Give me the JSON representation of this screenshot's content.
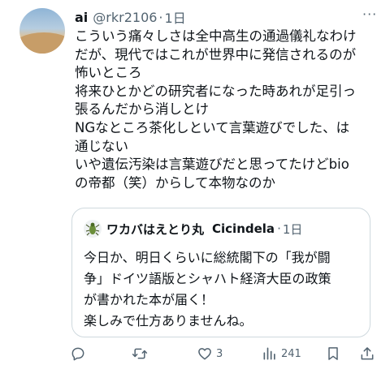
{
  "tweet": {
    "author_name": "ai",
    "author_handle": "@rkr2106",
    "time_sep": "·",
    "time": "1日",
    "more": "···",
    "lines": [
      "こういう痛々しさは全中高生の通過儀礼なわけ",
      "だが、現代ではこれが世界中に発信されるのが",
      "怖いところ",
      "将来ひとかどの研究者になった時あれが足引っ",
      "張るんだから消しとけ",
      "NGなところ茶化しといて言葉遊びでした、は",
      "通じない",
      "いや遺伝汚染は言葉遊びだと思ってたけどbio",
      "の帝都（笑）からして本物なのか"
    ]
  },
  "quoted": {
    "author_name": "ワカバはえとり丸",
    "author_handle": "Cicindela",
    "time_sep": "·",
    "time": "1日",
    "lines": [
      "今日か、明日くらいに総統閣下の「我が闘",
      "争」ドイツ語版とシャハト経済大臣の政策",
      "が書かれた本が届く！",
      "楽しみで仕方ありませんね。"
    ]
  },
  "actions": {
    "reply_count": "",
    "retweet_count": "",
    "like_count": "3",
    "views_count": "241"
  },
  "icons": {
    "reply": "reply-icon",
    "retweet": "retweet-icon",
    "like": "heart-icon",
    "views": "views-icon",
    "bookmark": "bookmark-icon",
    "share": "share-icon"
  },
  "colors": {
    "text": "#0f1419",
    "secondary": "#536471",
    "border": "#cfd9de"
  }
}
